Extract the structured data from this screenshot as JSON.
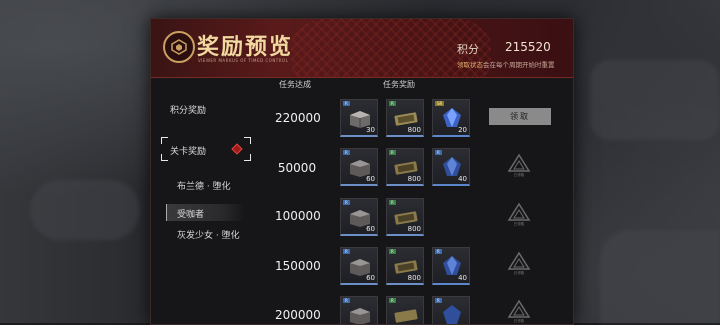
{
  "header": {
    "title": "奖励预览",
    "subtitle": "VIEWER MARKUS OF TIMED CONTROL",
    "score_label": "积分",
    "score_value": "215520",
    "hint_highlight": "领取状态",
    "hint_rest": "会在每个周期开始时重置"
  },
  "sidebar": {
    "items": [
      {
        "label": "积分奖励"
      },
      {
        "label": "关卡奖励"
      },
      {
        "label": "布兰德 · 堕化"
      },
      {
        "label": "受咖者"
      },
      {
        "label": "灰发少女 · 堕化"
      }
    ]
  },
  "columns": {
    "target": "任务达成",
    "reward": "任务奖励"
  },
  "rows": [
    {
      "target": "220000",
      "rewards": [
        {
          "qty": "30"
        },
        {
          "qty": "800"
        },
        {
          "qty": "20"
        }
      ],
      "action": "领取"
    },
    {
      "target": "50000",
      "rewards": [
        {
          "qty": "60"
        },
        {
          "qty": "800"
        },
        {
          "qty": "40"
        }
      ],
      "action": "已领取"
    },
    {
      "target": "100000",
      "rewards": [
        {
          "qty": "60"
        },
        {
          "qty": "800"
        }
      ],
      "action": "已领取"
    },
    {
      "target": "150000",
      "rewards": [
        {
          "qty": "60"
        },
        {
          "qty": "800"
        },
        {
          "qty": "40"
        }
      ],
      "action": "已领取"
    },
    {
      "target": "200000",
      "rewards": [
        {
          "qty": ""
        },
        {
          "qty": ""
        },
        {
          "qty": ""
        }
      ],
      "action": "已领取"
    }
  ],
  "icons": {
    "crate": "crate-icon",
    "ticket": "ticket-icon",
    "crystal": "crystal-icon",
    "emblem": "emblem-icon",
    "claimed": "claimed-stamp-icon"
  },
  "colors": {
    "header_red": "#5a1a1a",
    "accent_gold": "#f1d9a0",
    "selected_diamond": "#e2453b",
    "claim_button": "#8a8a8a"
  }
}
